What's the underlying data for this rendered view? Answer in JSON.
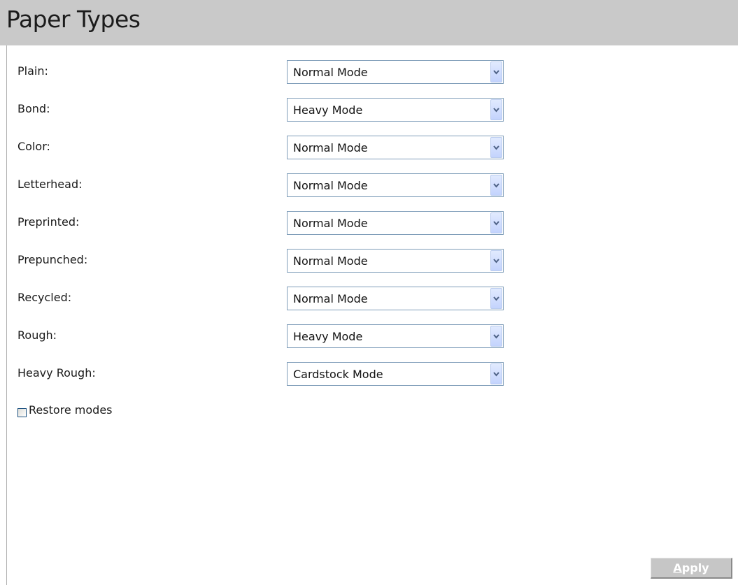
{
  "header": {
    "title": "Paper Types"
  },
  "rows": [
    {
      "label": "Plain:",
      "value": "Normal Mode"
    },
    {
      "label": "Bond:",
      "value": "Heavy Mode"
    },
    {
      "label": "Color:",
      "value": "Normal Mode"
    },
    {
      "label": "Letterhead:",
      "value": "Normal Mode"
    },
    {
      "label": "Preprinted:",
      "value": "Normal Mode"
    },
    {
      "label": "Prepunched:",
      "value": "Normal Mode"
    },
    {
      "label": "Recycled:",
      "value": "Normal Mode"
    },
    {
      "label": "Rough:",
      "value": "Heavy Mode"
    },
    {
      "label": "Heavy Rough:",
      "value": "Cardstock Mode"
    }
  ],
  "restore": {
    "label": "Restore modes",
    "checked": false
  },
  "apply": {
    "label_first": "A",
    "label_rest": "pply",
    "enabled": false
  },
  "colors": {
    "header_bg": "#c9c9c9",
    "select_border": "#7f9db9",
    "dropdown_button": "#c3d3fd",
    "dropdown_arrow": "#4d6185",
    "apply_disabled_bg": "#c6c6c6"
  },
  "icons": {
    "dropdown": "chevron-down-icon",
    "checkbox": "checkbox-unchecked"
  }
}
